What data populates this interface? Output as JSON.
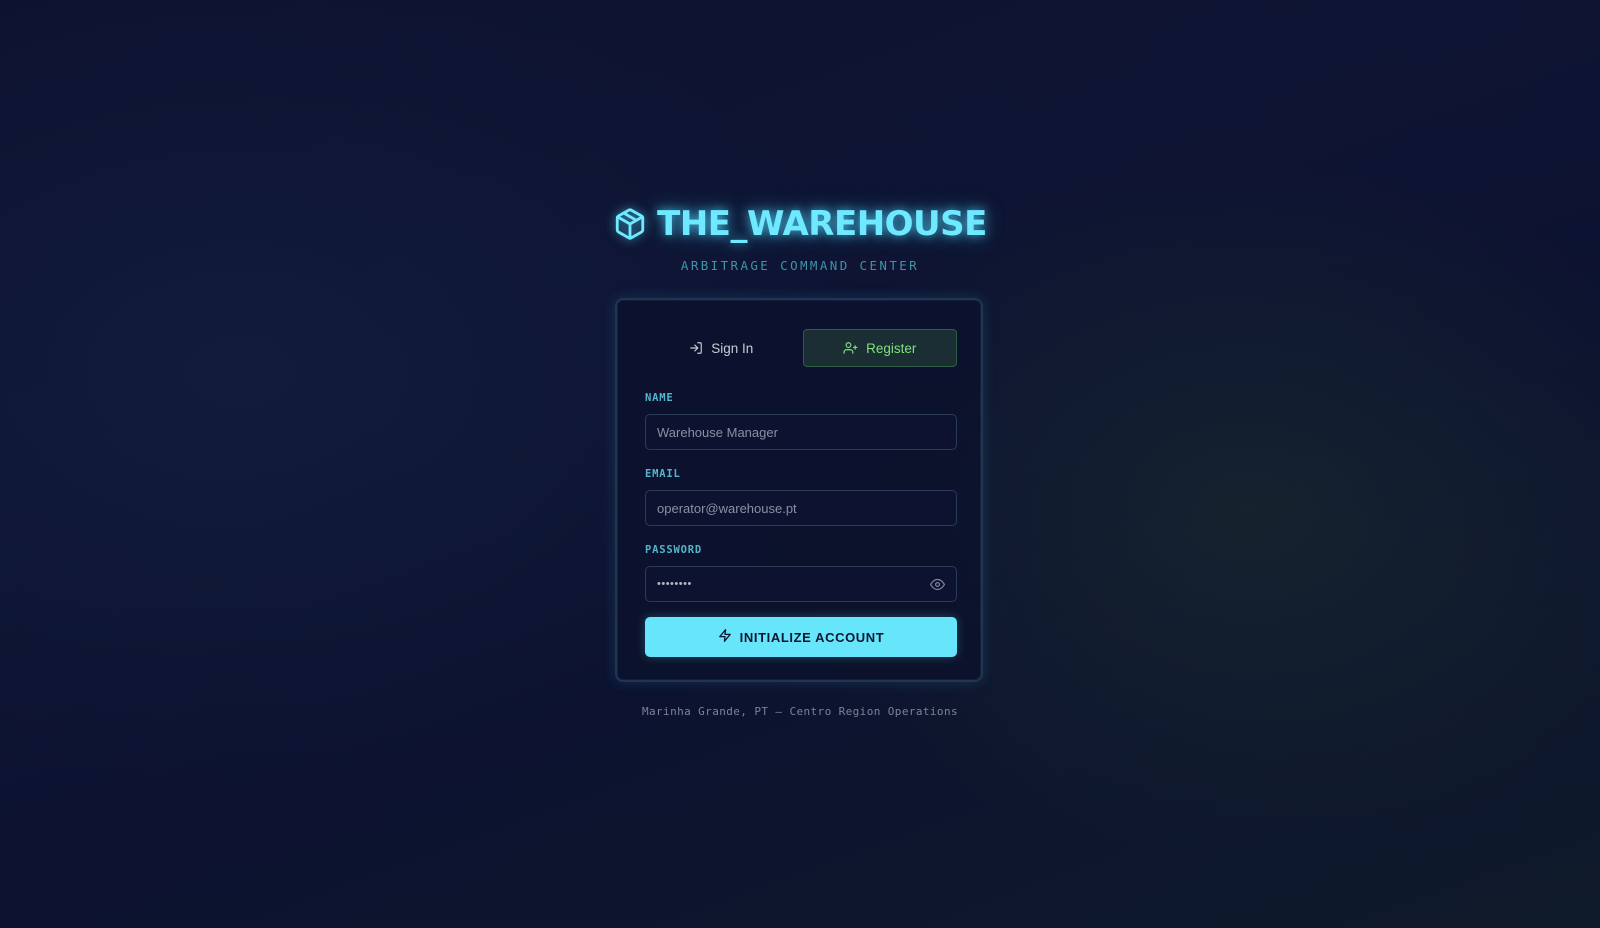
{
  "brand": {
    "icon": "package-cube-icon",
    "title": "THE_WAREHOUSE",
    "subtitle": "ARBITRAGE COMMAND CENTER",
    "accent_color": "#6fe9ff"
  },
  "auth_card": {
    "tabs": [
      {
        "label": "Sign In",
        "icon": "log-in-icon",
        "active": false
      },
      {
        "label": "Register",
        "icon": "user-plus-icon",
        "active": true
      }
    ],
    "fields": {
      "name": {
        "label": "NAME",
        "placeholder": "Warehouse Manager",
        "value": ""
      },
      "email": {
        "label": "EMAIL",
        "placeholder": "operator@warehouse.pt",
        "value": ""
      },
      "password": {
        "label": "PASSWORD",
        "masked_value": "••••••••",
        "toggle_icon": "eye-icon"
      }
    },
    "submit": {
      "label": "INITIALIZE ACCOUNT",
      "icon": "zap-icon",
      "color": "#67e6fb"
    },
    "active_tab_color": "#7fe07c"
  },
  "footer": {
    "text": "Marinha Grande, PT — Centro Region Operations"
  }
}
